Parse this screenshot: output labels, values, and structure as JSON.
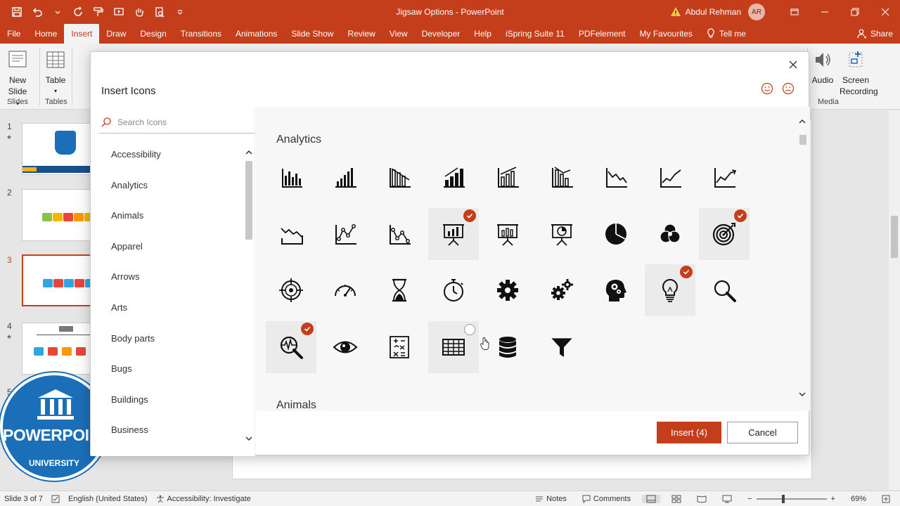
{
  "window": {
    "title": "Jigsaw Options  -  PowerPoint",
    "user_name": "Abdul Rehman",
    "user_initials": "AR"
  },
  "menu": {
    "tabs": [
      "File",
      "Home",
      "Insert",
      "Draw",
      "Design",
      "Transitions",
      "Animations",
      "Slide Show",
      "Review",
      "View",
      "Developer",
      "Help",
      "iSpring Suite 11",
      "PDFelement",
      "My Favourites"
    ],
    "active_tab": "Insert",
    "tell_me": "Tell me",
    "share": "Share"
  },
  "ribbon": {
    "new_slide_line1": "New",
    "new_slide_line2": "Slide",
    "table": "Table",
    "audio": "Audio",
    "screen_recording_line1": "Screen",
    "screen_recording_line2": "Recording",
    "group_slides": "Slides",
    "group_tables": "Tables",
    "group_media": "Media"
  },
  "slides": {
    "numbers": [
      "1",
      "2",
      "3",
      "4",
      "5"
    ],
    "current": "3"
  },
  "logo": {
    "line1": "POWERPOINT",
    "line2": "UNIVERSITY"
  },
  "dialog": {
    "title": "Insert Icons",
    "search_placeholder": "Search Icons",
    "categories": [
      "Accessibility",
      "Analytics",
      "Animals",
      "Apparel",
      "Arrows",
      "Arts",
      "Body parts",
      "Bugs",
      "Buildings",
      "Business"
    ],
    "section_analytics": "Analytics",
    "section_animals": "Animals",
    "insert_label": "Insert (4)",
    "cancel_label": "Cancel",
    "icons": [
      {
        "name": "bar-chart-icon",
        "selected": false
      },
      {
        "name": "bar-chart-ascending-icon",
        "selected": false
      },
      {
        "name": "bar-chart-trend-down-icon",
        "selected": false
      },
      {
        "name": "bar-chart-trend-up-icon",
        "selected": false
      },
      {
        "name": "bar-chart-trend-line-icon",
        "selected": false
      },
      {
        "name": "bar-chart-decline-icon",
        "selected": false
      },
      {
        "name": "line-chart-down-icon",
        "selected": false
      },
      {
        "name": "line-chart-up-icon",
        "selected": false
      },
      {
        "name": "line-chart-arrow-icon",
        "selected": false
      },
      {
        "name": "line-chart-wave-icon",
        "selected": false
      },
      {
        "name": "line-chart-nodes-icon",
        "selected": false
      },
      {
        "name": "line-chart-nodes-down-icon",
        "selected": false
      },
      {
        "name": "presentation-bar-chart-icon",
        "selected": true
      },
      {
        "name": "presentation-chart-icon",
        "selected": false
      },
      {
        "name": "presentation-pie-chart-icon",
        "selected": false
      },
      {
        "name": "pie-chart-icon",
        "selected": false
      },
      {
        "name": "venn-diagram-icon",
        "selected": false
      },
      {
        "name": "target-arrow-icon",
        "selected": true
      },
      {
        "name": "crosshair-target-icon",
        "selected": false
      },
      {
        "name": "speedometer-icon",
        "selected": false
      },
      {
        "name": "hourglass-icon",
        "selected": false
      },
      {
        "name": "stopwatch-icon",
        "selected": false
      },
      {
        "name": "gear-icon",
        "selected": false
      },
      {
        "name": "gears-icon",
        "selected": false
      },
      {
        "name": "head-gears-icon",
        "selected": false
      },
      {
        "name": "lightbulb-icon",
        "selected": true
      },
      {
        "name": "magnifier-icon",
        "selected": false
      },
      {
        "name": "magnifier-pulse-icon",
        "selected": true
      },
      {
        "name": "eye-icon",
        "selected": false
      },
      {
        "name": "calculator-formula-icon",
        "selected": false
      },
      {
        "name": "table-grid-icon",
        "selected": false,
        "hover": true
      },
      {
        "name": "database-icon",
        "selected": false
      },
      {
        "name": "funnel-icon",
        "selected": false
      }
    ]
  },
  "status": {
    "slide_count": "Slide 3 of 7",
    "language": "English (United States)",
    "accessibility": "Accessibility: Investigate",
    "notes": "Notes",
    "comments": "Comments",
    "zoom": "69%"
  }
}
